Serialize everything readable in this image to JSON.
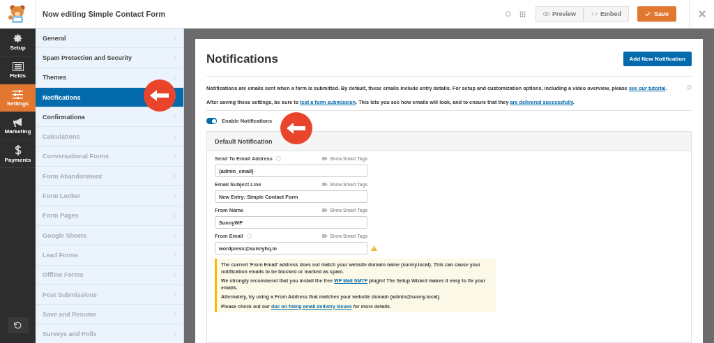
{
  "header": {
    "title": "Now editing Simple Contact Form",
    "buttons": [
      {
        "label": "Preview",
        "kind": "preview"
      },
      {
        "label": "Embed",
        "kind": "embed"
      }
    ],
    "save": "Save"
  },
  "rail": [
    {
      "label": "Setup",
      "kind": "gear",
      "selected": false
    },
    {
      "label": "Fields",
      "kind": "list",
      "selected": false
    },
    {
      "label": "Settings",
      "kind": "sliders",
      "selected": true
    },
    {
      "label": "Marketing",
      "kind": "megaphone",
      "selected": false
    },
    {
      "label": "Payments",
      "kind": "dollar",
      "selected": false
    }
  ],
  "nav": [
    {
      "label": "General",
      "selected": false,
      "disabled": false
    },
    {
      "label": "Spam Protection and Security",
      "selected": false,
      "disabled": false
    },
    {
      "label": "Themes",
      "selected": false,
      "disabled": false
    },
    {
      "label": "Notifications",
      "selected": true,
      "disabled": false
    },
    {
      "label": "Confirmations",
      "selected": false,
      "disabled": false
    },
    {
      "label": "Calculations",
      "selected": false,
      "disabled": true
    },
    {
      "label": "Conversational Forms",
      "selected": false,
      "disabled": true
    },
    {
      "label": "Form Abandonment",
      "selected": false,
      "disabled": true
    },
    {
      "label": "Form Locker",
      "selected": false,
      "disabled": true
    },
    {
      "label": "Form Pages",
      "selected": false,
      "disabled": true
    },
    {
      "label": "Google Sheets",
      "selected": false,
      "disabled": true
    },
    {
      "label": "Lead Forms",
      "selected": false,
      "disabled": true
    },
    {
      "label": "Offline Forms",
      "selected": false,
      "disabled": true
    },
    {
      "label": "Post Submissions",
      "selected": false,
      "disabled": true
    },
    {
      "label": "Save and Resume",
      "selected": false,
      "disabled": true
    },
    {
      "label": "Surveys and Polls",
      "selected": false,
      "disabled": true
    }
  ],
  "page": {
    "title": "Notifications",
    "add_button": "Add New Notification",
    "intro": [
      [
        {
          "kind": "text",
          "text": "Notifications are emails sent when a form is submitted. By default, these emails include entry details. For setup and customization options, including a video overview, please "
        },
        {
          "kind": "link",
          "text": "see our tutorial"
        },
        {
          "kind": "text",
          "text": "."
        }
      ],
      [
        {
          "kind": "text",
          "text": "After saving these settings, be sure to "
        },
        {
          "kind": "link",
          "text": "test a form submission"
        },
        {
          "kind": "text",
          "text": ". This lets you see how emails will look, and to ensure that they "
        },
        {
          "kind": "link",
          "text": "are delivered successfully"
        },
        {
          "kind": "text",
          "text": "."
        }
      ]
    ],
    "toggle": {
      "label": "Enable Notifications",
      "on": true
    },
    "panel": {
      "title": "Default Notification",
      "fields": [
        {
          "label": "Send To Email Address",
          "help": true,
          "warning": false,
          "smart_tags": "Show Smart Tags",
          "value": "{admin_email}"
        },
        {
          "label": "Email Subject Line",
          "help": false,
          "warning": false,
          "smart_tags": "Show Smart Tags",
          "value": "New Entry: Simple Contact Form"
        },
        {
          "label": "From Name",
          "help": false,
          "warning": false,
          "smart_tags": "Show Smart Tags",
          "value": "SunnyWP"
        },
        {
          "label": "From Email",
          "help": true,
          "warning": true,
          "smart_tags": "Show Smart Tags",
          "value": "wordpress@sunnyhq.io"
        }
      ],
      "notice": [
        [
          {
            "kind": "text",
            "text": "The current 'From Email' address does not match your website domain name (sunny.local). This can cause your notification emails to be blocked or marked as spam."
          }
        ],
        [
          {
            "kind": "text",
            "text": "We strongly recommend that you install the free "
          },
          {
            "kind": "link",
            "text": "WP Mail SMTP"
          },
          {
            "kind": "text",
            "text": " plugin! The Setup Wizard makes it easy to fix your emails."
          }
        ],
        [
          {
            "kind": "text",
            "text": "Alternately, try using a From Address that matches your website domain (admin@sunny.local)."
          }
        ],
        [
          {
            "kind": "text",
            "text": "Please check out our "
          },
          {
            "kind": "link",
            "text": "doc on fixing email delivery issues"
          },
          {
            "kind": "text",
            "text": " for more details."
          }
        ]
      ]
    }
  }
}
